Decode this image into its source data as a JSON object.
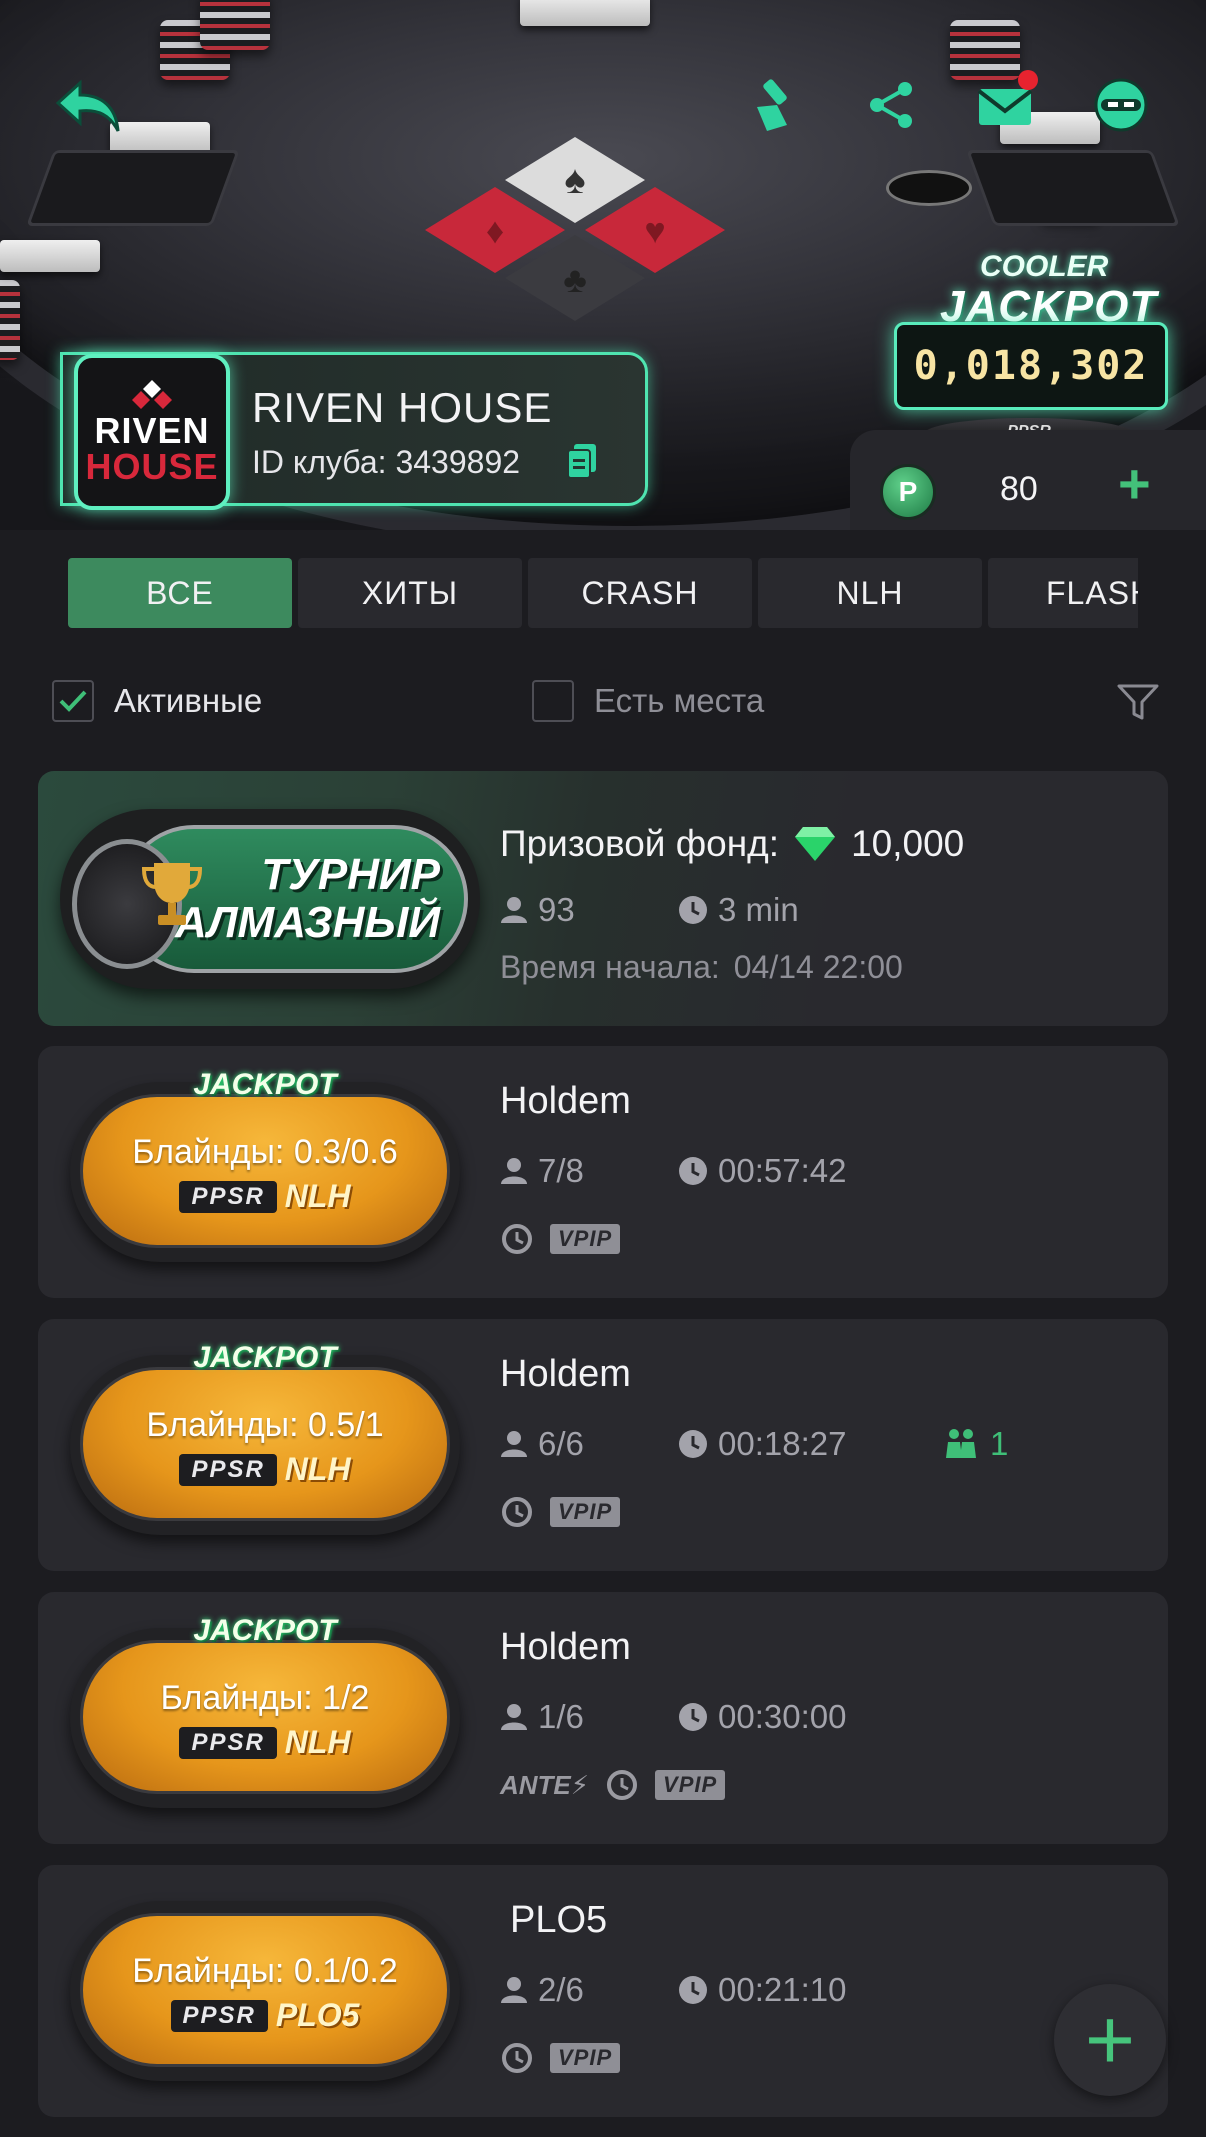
{
  "club": {
    "name": "RIVEN HOUSE",
    "id_label": "ID клуба:",
    "id_value": "3439892",
    "logo_line1": "RIVEN",
    "logo_line2": "HOUSE"
  },
  "jackpot": {
    "cooler": "COOLER",
    "title": "JACKPOT",
    "value": "0,018,302",
    "brand": "PPSR"
  },
  "balance": {
    "coin_letter": "P",
    "amount": "80"
  },
  "tabs": [
    {
      "label": "ВСЕ",
      "active": true
    },
    {
      "label": "ХИТЫ",
      "active": false
    },
    {
      "label": "CRASH",
      "active": false
    },
    {
      "label": "NLH",
      "active": false
    },
    {
      "label": "FLASH",
      "active": false
    }
  ],
  "filters": {
    "active_label": "Активные",
    "active_checked": true,
    "seats_label": "Есть места",
    "seats_checked": false
  },
  "tournament": {
    "badge_line1": "ТУРНИР",
    "badge_line2": "АЛМАЗНЫЙ",
    "prize_label": "Призовой фонд:",
    "prize_value": "10,000",
    "players": "93",
    "duration": "3 min",
    "start_label": "Время начала:",
    "start_value": "04/14 22:00"
  },
  "games": [
    {
      "jackpot_label": "JACKPOT",
      "blinds_label": "Блайнды:",
      "blinds_value": "0.3/0.6",
      "brand": "PPSR",
      "game_type": "NLH",
      "title": "Holdem",
      "seats": "7/8",
      "time": "00:57:42",
      "waiting": "",
      "ante": "",
      "vpip": "VPIP"
    },
    {
      "jackpot_label": "JACKPOT",
      "blinds_label": "Блайнды:",
      "blinds_value": "0.5/1",
      "brand": "PPSR",
      "game_type": "NLH",
      "title": "Holdem",
      "seats": "6/6",
      "time": "00:18:27",
      "waiting": "1",
      "ante": "",
      "vpip": "VPIP"
    },
    {
      "jackpot_label": "JACKPOT",
      "blinds_label": "Блайнды:",
      "blinds_value": "1/2",
      "brand": "PPSR",
      "game_type": "NLH",
      "title": "Holdem",
      "seats": "1/6",
      "time": "00:30:00",
      "waiting": "",
      "ante": "ANTE",
      "vpip": "VPIP"
    },
    {
      "jackpot_label": "",
      "blinds_label": "Блайнды:",
      "blinds_value": "0.1/0.2",
      "brand": "PPSR",
      "game_type": "PLO5",
      "title": "PLO5",
      "seats": "2/6",
      "time": "00:21:10",
      "waiting": "",
      "ante": "",
      "vpip": "VPIP"
    }
  ],
  "colors": {
    "accent_green": "#3d8a5e",
    "bright_green": "#46c47c",
    "badge_orange": "#e6961b",
    "glow_mint": "#59ecbc",
    "notification_red": "#e8232f"
  },
  "icons": {
    "back": "back-arrow-icon",
    "broom": "broom-icon",
    "share": "share-icon",
    "mail": "mail-icon",
    "avatar": "ninja-avatar-icon",
    "copy": "copy-icon",
    "filter": "filter-funnel-icon",
    "player": "person-icon",
    "clock": "clock-icon",
    "waitlist": "group-icon",
    "replay": "replay-icon",
    "diamond": "diamond-icon",
    "add": "plus-icon"
  }
}
